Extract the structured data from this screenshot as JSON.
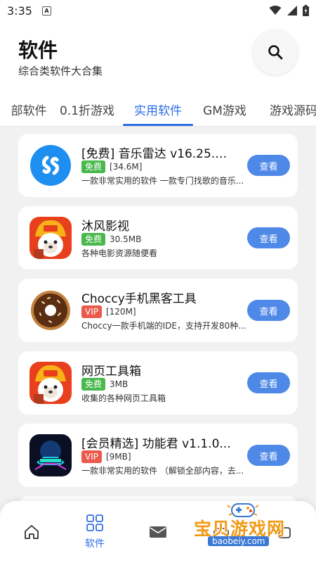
{
  "status_bar": {
    "time": "3:35",
    "notification_glyph": "A"
  },
  "header": {
    "title": "软件",
    "subtitle": "综合类软件大合集",
    "search_icon": "search-icon"
  },
  "tabs": [
    {
      "label": "部软件"
    },
    {
      "label": "0.1折游戏"
    },
    {
      "label": "实用软件",
      "active": true
    },
    {
      "label": "GM游戏"
    },
    {
      "label": "游戏源码"
    }
  ],
  "apps": [
    {
      "name": "[免费] 音乐雷达  v16.25.0...",
      "tag": "免费",
      "size": "[34.6M]",
      "desc": "一款非常实用的软件 一款专门找歌的音乐...",
      "button": "查看"
    },
    {
      "name": "沐风影视",
      "tag": "免费",
      "size": "30.5MB",
      "desc": "各种电影资源随便看",
      "button": "查看"
    },
    {
      "name": "Choccy手机黑客工具",
      "tag": "VIP",
      "size": "[120M]",
      "desc": "Choccy一款手机端的IDE，支持开发80种...",
      "button": "查看"
    },
    {
      "name": "网页工具箱",
      "tag": "免费",
      "size": "3MB",
      "desc": "收集的各种网页工具箱",
      "button": "查看"
    },
    {
      "name": "[会员精选] 功能君 v1.1.0...",
      "tag": "VIP",
      "size": "[9MB]",
      "desc": "一款非常实用的软件 （解锁全部内容，去...",
      "button": "查看"
    }
  ],
  "bottom_nav": {
    "items": [
      {
        "icon": "home-icon"
      },
      {
        "icon": "apps-grid-icon",
        "label": "软件",
        "active": true
      },
      {
        "icon": "message-icon"
      },
      {
        "icon": "gamepad-icon"
      },
      {
        "icon": "profile-icon"
      }
    ]
  },
  "watermark": {
    "title": "宝贝游戏网",
    "url": "baobeiy.com"
  },
  "colors": {
    "accent": "#2f6fe4",
    "button": "#4f89e8",
    "free_tag": "#49b84d",
    "vip_tag": "#ea5a4c"
  }
}
